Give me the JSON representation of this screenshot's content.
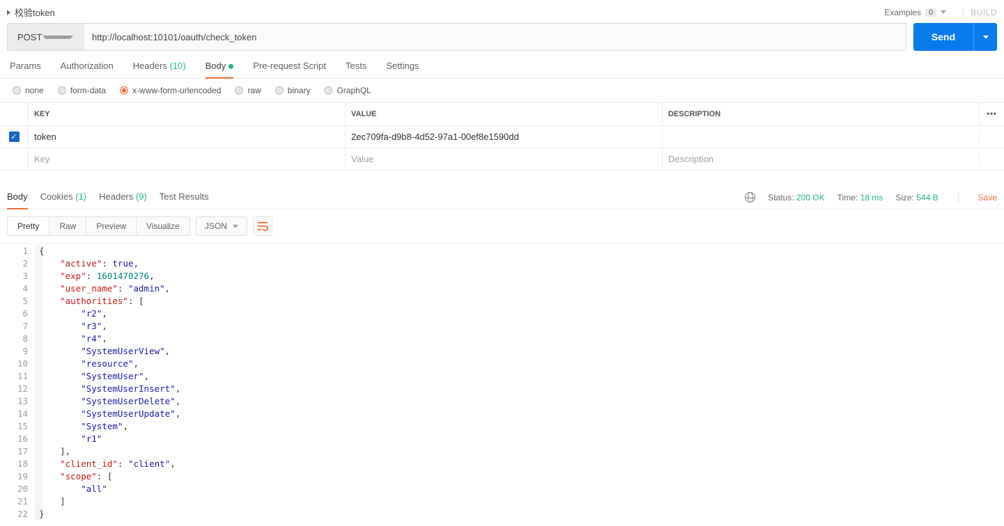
{
  "header": {
    "title": "校验token",
    "examples_label": "Examples",
    "examples_count": "0",
    "build_label": "BUILD"
  },
  "request": {
    "method": "POST",
    "url": "http://localhost:10101/oauth/check_token",
    "send_label": "Send",
    "tabs": {
      "params": "Params",
      "authorization": "Authorization",
      "headers_label": "Headers",
      "headers_count": "(10)",
      "body": "Body",
      "prerequest": "Pre-request Script",
      "tests": "Tests",
      "settings": "Settings"
    },
    "body_types": {
      "none": "none",
      "form_data": "form-data",
      "urlencoded": "x-www-form-urlencoded",
      "raw": "raw",
      "binary": "binary",
      "graphql": "GraphQL"
    },
    "kv": {
      "header_key": "KEY",
      "header_value": "VALUE",
      "header_desc": "DESCRIPTION",
      "rows": [
        {
          "checked": true,
          "key": "token",
          "value": "2ec709fa-d9b8-4d52-97a1-00ef8e1590dd",
          "desc": ""
        }
      ],
      "placeholder_key": "Key",
      "placeholder_value": "Value",
      "placeholder_desc": "Description"
    }
  },
  "response": {
    "tabs": {
      "body": "Body",
      "cookies_label": "Cookies",
      "cookies_count": "(1)",
      "headers_label": "Headers",
      "headers_count": "(9)",
      "test_results": "Test Results"
    },
    "meta": {
      "status_label": "Status:",
      "status_value": "200 OK",
      "time_label": "Time:",
      "time_value": "18 ms",
      "size_label": "Size:",
      "size_value": "544 B",
      "save_label": "Save"
    },
    "viewer": {
      "pretty": "Pretty",
      "raw": "Raw",
      "preview": "Preview",
      "visualize": "Visualize",
      "lang": "JSON"
    },
    "body_json": {
      "active": true,
      "exp": 1601470276,
      "user_name": "admin",
      "authorities": [
        "r2",
        "r3",
        "r4",
        "SystemUserView",
        "resource",
        "SystemUser",
        "SystemUserInsert",
        "SystemUserDelete",
        "SystemUserUpdate",
        "System",
        "r1"
      ],
      "client_id": "client",
      "scope": [
        "all"
      ]
    }
  }
}
